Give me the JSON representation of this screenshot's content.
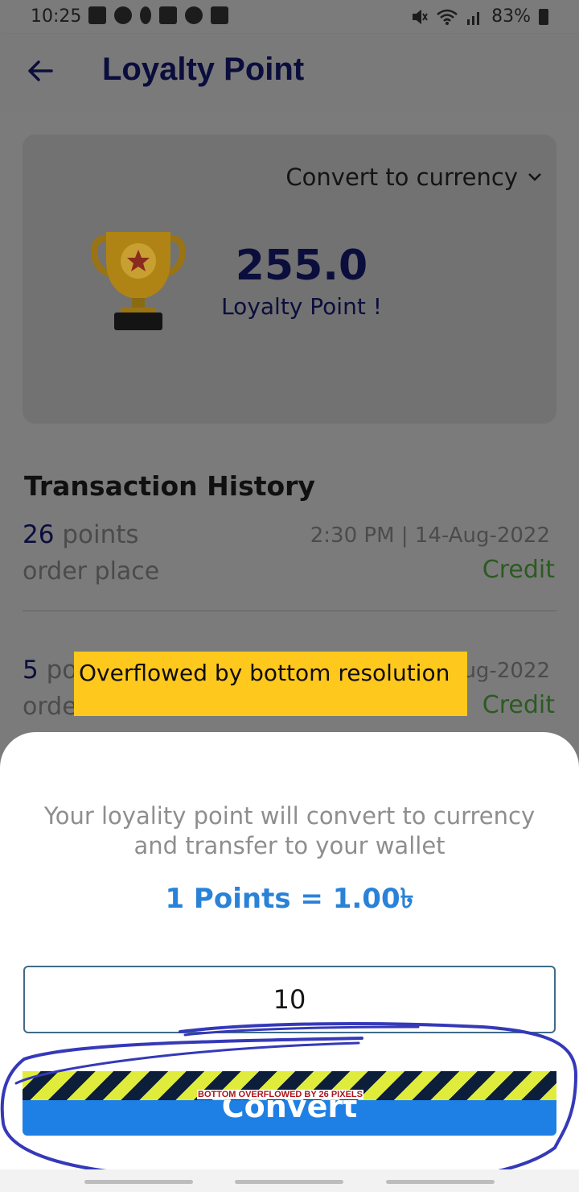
{
  "status_bar": {
    "time": "10:25",
    "battery": "83%",
    "left_icons": [
      "facebook-icon",
      "notification-icon",
      "keyhole-icon",
      "folder-icon",
      "whatsapp-icon",
      "gallery-icon"
    ],
    "right_icons": [
      "mute-icon",
      "wifi-icon",
      "signal-icon",
      "battery-icon"
    ]
  },
  "app_bar": {
    "title": "Loyalty Point",
    "back_icon": "back-arrow-icon"
  },
  "card": {
    "dropdown_label": "Convert to currency",
    "points_value": "255.0",
    "points_label": "Loyalty Point !",
    "trophy_icon": "trophy-icon"
  },
  "history": {
    "title": "Transaction History",
    "transactions": [
      {
        "amount": "26",
        "unit": "points",
        "description": "order place",
        "datetime": "2:30 PM | 14-Aug-2022",
        "type": "Credit"
      },
      {
        "amount": "5",
        "unit": "po",
        "description": "orde",
        "datetime": "ug-2022",
        "type": "Credit"
      }
    ]
  },
  "overflow_notice": "Overflowed by bottom resolution",
  "sheet": {
    "message": "Your loyality point will convert to currency and transfer to your wallet",
    "rate": "1 Points = 1.00৳",
    "input_value": "10",
    "button_label": "Convert",
    "overflow_banner": "BOTTOM OVERFLOWED BY 26 PIXELS"
  },
  "colors": {
    "accent_blue": "#1e80e5",
    "rate_blue": "#2a82d8",
    "title_navy": "#0b0e3c",
    "credit_green": "#2d5a22",
    "overflow_yellow": "#ffc81d",
    "scrim_gray": "#7b7b7b"
  }
}
